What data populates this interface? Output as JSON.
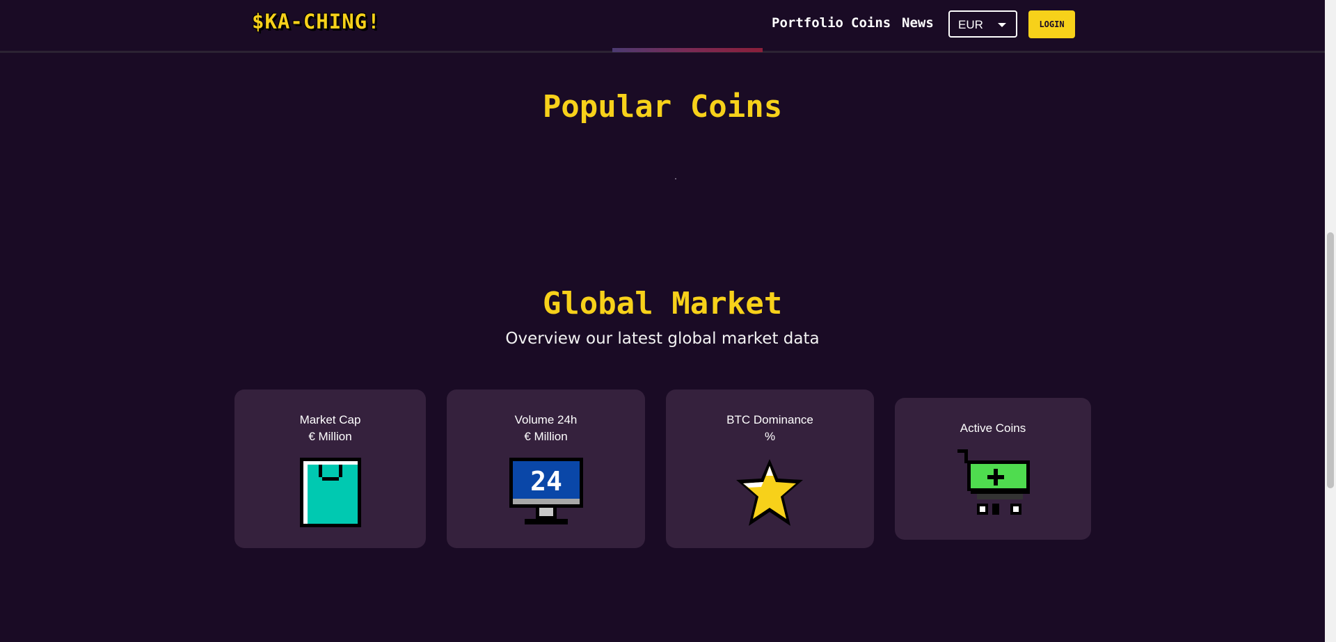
{
  "header": {
    "logo_text": "$KA-CHING!",
    "nav": {
      "portfolio": "Portfolio",
      "coins": "Coins",
      "news": "News"
    },
    "currency": {
      "selected": "EUR"
    },
    "login_label": "LOGIN"
  },
  "popular": {
    "title": "Popular Coins"
  },
  "global_market": {
    "title": "Global Market",
    "subtitle": "Overview our latest global market data",
    "cards": [
      {
        "label": "Market Cap",
        "unit": "€ Million",
        "icon": "shopping-bag-icon",
        "color": "#00c9b1"
      },
      {
        "label": "Volume 24h",
        "unit": "€ Million",
        "icon": "monitor-24-icon",
        "color": "#0a47a8",
        "icon_text": "24"
      },
      {
        "label": "BTC Dominance",
        "unit": "%",
        "icon": "star-icon",
        "color": "#f7d11a"
      },
      {
        "label": "Active Coins",
        "unit": "",
        "icon": "shopping-cart-add-icon",
        "color": "#4fdc4f"
      }
    ]
  },
  "colors": {
    "background": "#1a0b25",
    "accent": "#f7d11a",
    "card": "#35213d"
  }
}
